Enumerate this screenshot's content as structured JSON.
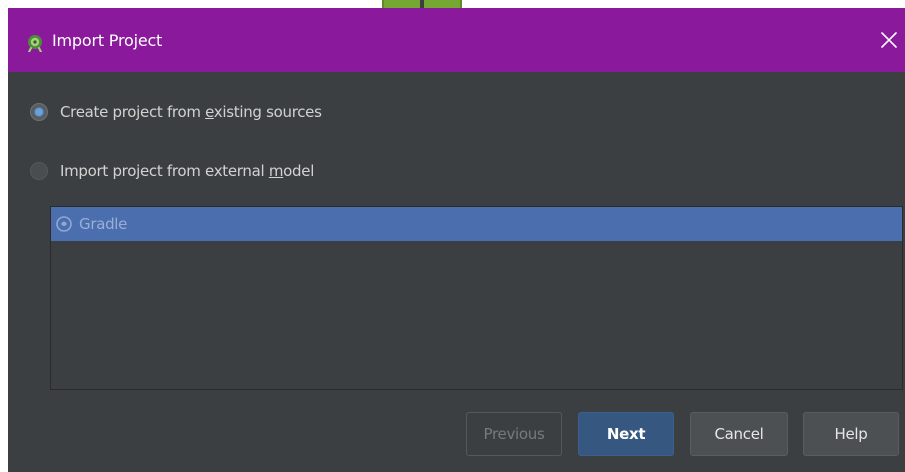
{
  "window": {
    "title": "Import Project",
    "app_icon": "android-studio-icon",
    "close_icon": "close-icon",
    "title_bar_color": "#8a1a9b",
    "background_color": "#3c3f41"
  },
  "options": {
    "create_from_sources": {
      "label_before": "Create project from ",
      "label_mnemonic": "e",
      "label_after": "xisting sources",
      "selected": true
    },
    "import_external": {
      "label_before": "Import project from external ",
      "label_mnemonic": "m",
      "label_after": "odel",
      "selected": false
    }
  },
  "model_list": {
    "items": [
      {
        "label": "Gradle",
        "icon": "gradle-icon",
        "selected": true
      }
    ],
    "selection_color": "#4b6eaf"
  },
  "buttons": {
    "previous": "Previous",
    "next": "Next",
    "cancel": "Cancel",
    "help": "Help"
  }
}
